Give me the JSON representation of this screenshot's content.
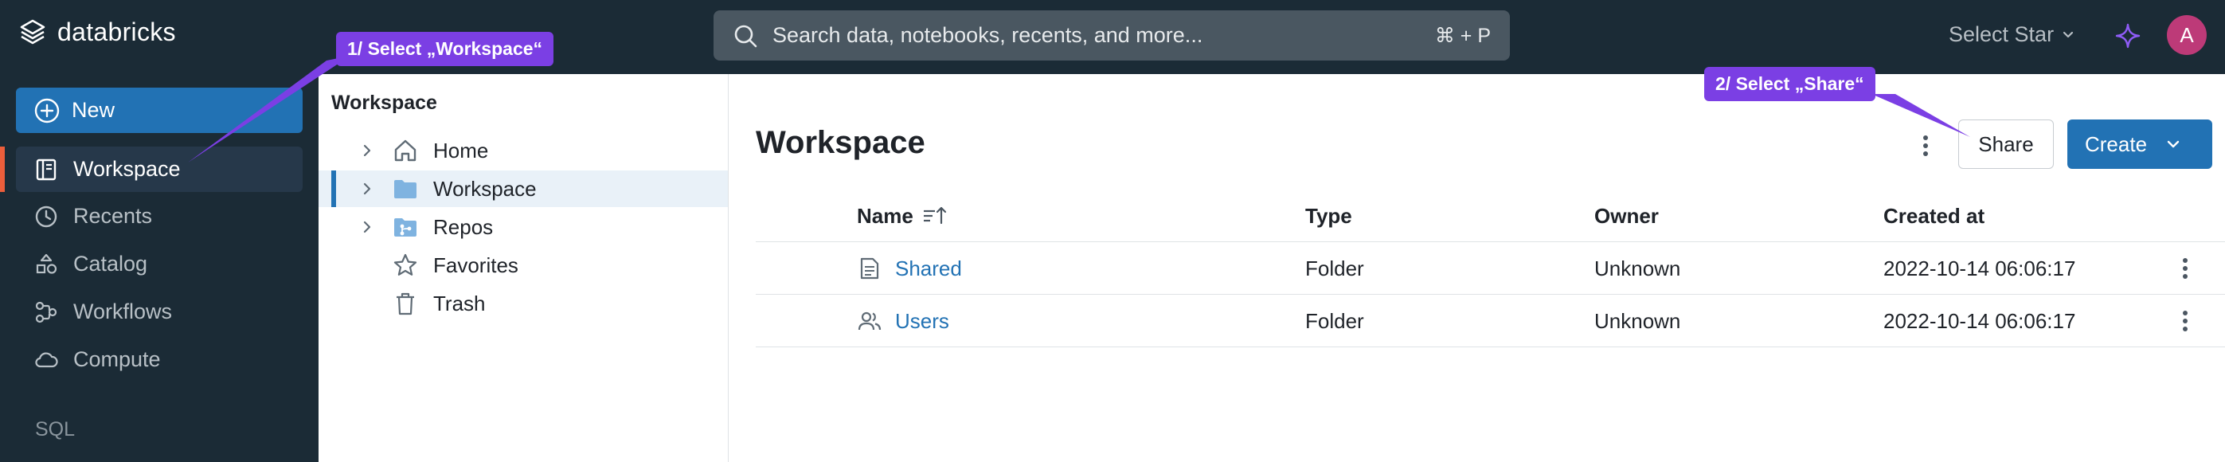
{
  "topbar": {
    "logo_text": "databricks",
    "search_placeholder": "Search data, notebooks, recents, and more...",
    "search_shortcut": "⌘ + P",
    "workspace_select": "Select Star",
    "avatar_initial": "A"
  },
  "sidebar": {
    "new_label": "New",
    "items": [
      {
        "label": "Workspace",
        "icon": "workspace-icon",
        "active": true
      },
      {
        "label": "Recents",
        "icon": "clock-icon"
      },
      {
        "label": "Catalog",
        "icon": "catalog-icon"
      },
      {
        "label": "Workflows",
        "icon": "workflows-icon"
      },
      {
        "label": "Compute",
        "icon": "cloud-icon"
      }
    ],
    "section_sql": "SQL"
  },
  "tree": {
    "title": "Workspace",
    "items": [
      {
        "label": "Home",
        "icon": "home-icon"
      },
      {
        "label": "Workspace",
        "icon": "folder-icon",
        "selected": true
      },
      {
        "label": "Repos",
        "icon": "repos-folder-icon"
      },
      {
        "label": "Favorites",
        "icon": "star-icon"
      },
      {
        "label": "Trash",
        "icon": "trash-icon"
      }
    ]
  },
  "main": {
    "title": "Workspace",
    "share_label": "Share",
    "create_label": "Create",
    "columns": [
      "Name",
      "Type",
      "Owner",
      "Created at"
    ],
    "rows": [
      {
        "name": "Shared",
        "icon": "shared-folder-icon",
        "type": "Folder",
        "owner": "Unknown",
        "created": "2022-10-14 06:06:17"
      },
      {
        "name": "Users",
        "icon": "users-folder-icon",
        "type": "Folder",
        "owner": "Unknown",
        "created": "2022-10-14 06:06:17"
      }
    ]
  },
  "annotations": {
    "step1": "1/ Select „Workspace“",
    "step2": "2/ Select „Share“"
  },
  "colors": {
    "accent": "#2272b4",
    "topbar": "#1b2b36",
    "callout": "#7b3fe4",
    "active_marker": "#ec5e3b"
  }
}
